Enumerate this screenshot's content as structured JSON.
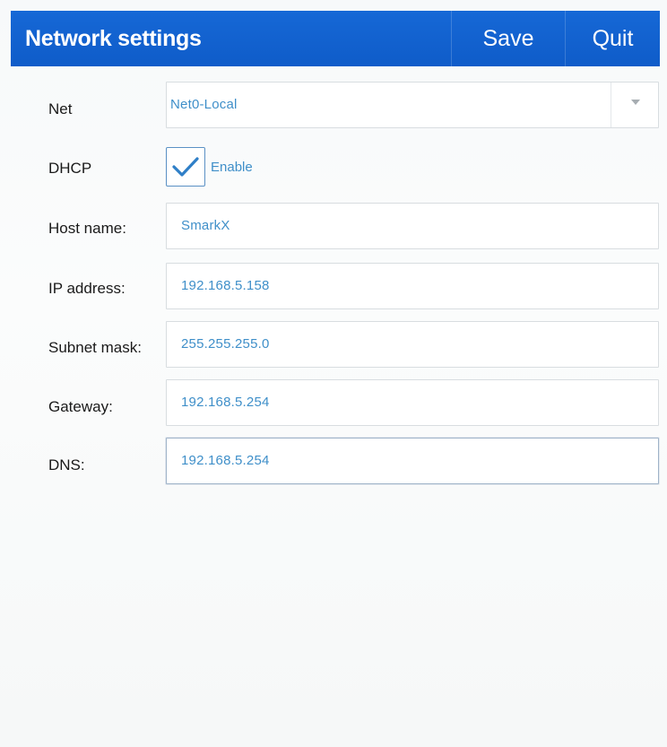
{
  "header": {
    "title": "Network settings",
    "save_label": "Save",
    "quit_label": "Quit"
  },
  "form": {
    "net": {
      "label": "Net",
      "value": "Net0-Local"
    },
    "dhcp": {
      "label": "DHCP",
      "checked": true,
      "option_label": "Enable"
    },
    "host_name": {
      "label": "Host name:",
      "value": "SmarkX"
    },
    "ip_address": {
      "label": "IP address:",
      "value": "192.168.5.158"
    },
    "subnet_mask": {
      "label": "Subnet mask:",
      "value": "255.255.255.0"
    },
    "gateway": {
      "label": "Gateway:",
      "value": "192.168.5.254"
    },
    "dns": {
      "label": "DNS:",
      "value": "192.168.5.254"
    }
  },
  "colors": {
    "title_bar": "#1265d2",
    "value_text": "#3f8fc9",
    "label_text": "#1a1a1a"
  },
  "icons": {
    "dropdown": "chevron-down-icon",
    "check": "checkmark-icon"
  }
}
